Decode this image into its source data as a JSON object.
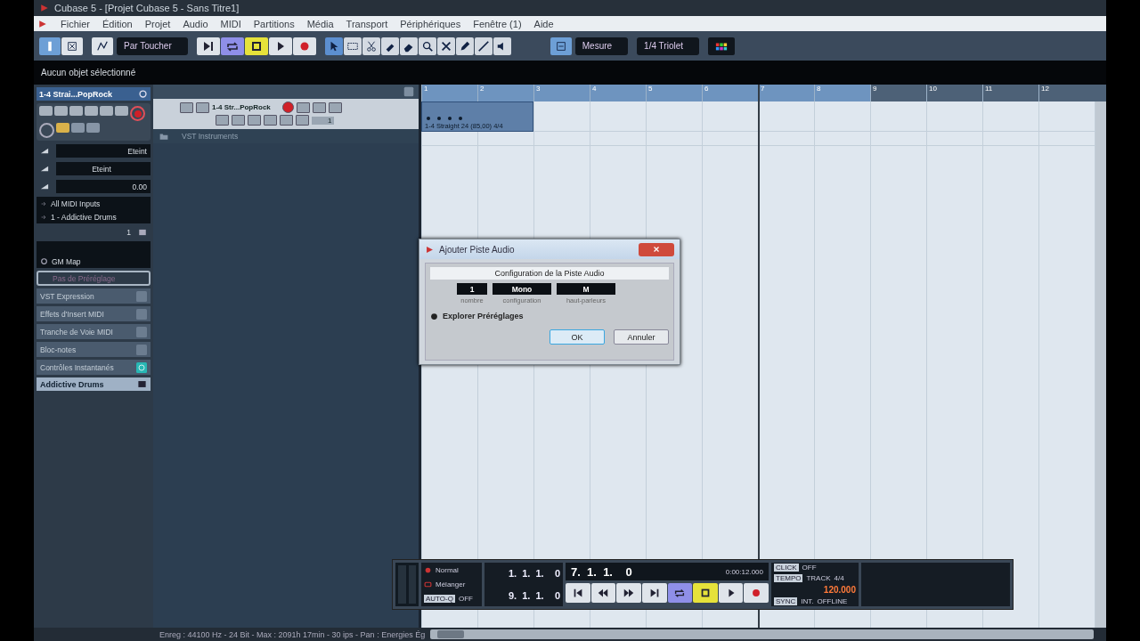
{
  "window": {
    "title": "Cubase 5 - [Projet Cubase 5 - Sans Titre1]"
  },
  "menu": [
    "Fichier",
    "Édition",
    "Projet",
    "Audio",
    "MIDI",
    "Partitions",
    "Média",
    "Transport",
    "Périphériques",
    "Fenêtre (1)",
    "Aide"
  ],
  "toolbar": {
    "automation_mode": "Par Toucher",
    "grid_type": "Mesure",
    "quantize": "1/4 Triolet",
    "transport_buttons": [
      {
        "kind": "goto-end",
        "on": false
      },
      {
        "kind": "cycle",
        "on": true
      },
      {
        "kind": "stop",
        "on": true
      },
      {
        "kind": "play",
        "on": false
      },
      {
        "kind": "record",
        "on": false
      }
    ],
    "tools": [
      {
        "kind": "arrow",
        "selected": true
      },
      {
        "kind": "range",
        "selected": false
      },
      {
        "kind": "split",
        "selected": false
      },
      {
        "kind": "glue",
        "selected": false
      },
      {
        "kind": "eraser",
        "selected": false
      },
      {
        "kind": "zoom",
        "selected": false
      },
      {
        "kind": "mute",
        "selected": false
      },
      {
        "kind": "pencil",
        "selected": false
      },
      {
        "kind": "line",
        "selected": false
      },
      {
        "kind": "play",
        "selected": false
      }
    ],
    "snap": {
      "on": true
    }
  },
  "info_line": "Aucun objet sélectionné",
  "inspector": {
    "track_name": "1-4 Strai...PopRock",
    "record_enabled": true,
    "volume": "Eteint",
    "pan": "Eteint",
    "delay": "0.00",
    "input": "All MIDI Inputs",
    "output": "1 - Addictive Drums",
    "channel": "1",
    "map": "GM Map",
    "preset_placeholder": "Pas de Préréglage",
    "sections": [
      {
        "label": "VST Expression",
        "active": false
      },
      {
        "label": "Effets d'Insert MIDI",
        "active": false
      },
      {
        "label": "Tranche de Voie MIDI",
        "active": false
      },
      {
        "label": "Bloc-notes",
        "active": false
      },
      {
        "label": "Contrôles Instantanés",
        "active": true
      }
    ],
    "instrument": "Addictive Drums"
  },
  "tracks": [
    {
      "kind": "midi",
      "name": "1-4 Str...PopRock",
      "selected": true,
      "record_enabled": true,
      "channel": "1"
    },
    {
      "kind": "folder",
      "name": "VST Instruments",
      "selected": false
    }
  ],
  "ruler": [
    {
      "label": "1",
      "in_cycle": true,
      "playhead": false
    },
    {
      "label": "2",
      "in_cycle": true,
      "playhead": false
    },
    {
      "label": "3",
      "in_cycle": true,
      "playhead": false
    },
    {
      "label": "4",
      "in_cycle": true,
      "playhead": false
    },
    {
      "label": "5",
      "in_cycle": true,
      "playhead": false
    },
    {
      "label": "6",
      "in_cycle": true,
      "playhead": false
    },
    {
      "label": "7",
      "in_cycle": true,
      "playhead": true
    },
    {
      "label": "8",
      "in_cycle": true,
      "playhead": false
    },
    {
      "label": "9",
      "in_cycle": false,
      "playhead": false
    },
    {
      "label": "10",
      "in_cycle": false,
      "playhead": false
    },
    {
      "label": "11",
      "in_cycle": false,
      "playhead": false
    },
    {
      "label": "12",
      "in_cycle": false,
      "playhead": false
    }
  ],
  "part": {
    "label": "1-4 Straight 24 (85,00) 4/4"
  },
  "dialog": {
    "title": "Ajouter Piste Audio",
    "heading": "Configuration de la Piste Audio",
    "fields": [
      {
        "value": "1",
        "label": "nombre"
      },
      {
        "value": "Mono",
        "label": "configuration"
      },
      {
        "value": "M",
        "label": "haut-parleurs"
      }
    ],
    "browse": "Explorer Préréglages",
    "ok": "OK",
    "cancel": "Annuler"
  },
  "transport": {
    "record_mode": "Normal",
    "cycle_mode": "Mélanger",
    "auto_q": "AUTO-Q",
    "auto_q_state": "OFF",
    "left_locator": "1.  1.  1.    0",
    "right_locator": "9.  1.  1.    0",
    "position": "7.  1.  1.    0",
    "time": "0:00:12.000",
    "buttons": [
      {
        "kind": "goto-start",
        "on": false
      },
      {
        "kind": "rewind",
        "on": false
      },
      {
        "kind": "forward",
        "on": false
      },
      {
        "kind": "goto-end",
        "on": false
      },
      {
        "kind": "cycle",
        "on": true
      },
      {
        "kind": "stop",
        "on": true
      },
      {
        "kind": "play",
        "on": false
      },
      {
        "kind": "record",
        "on": false
      }
    ],
    "click": "CLICK",
    "click_state": "OFF",
    "tempo": "TEMPO",
    "tempo_mode": "TRACK",
    "signature": "4/4",
    "bpm": "120.000",
    "sync": "SYNC",
    "sync_source": "INT.",
    "sync_state": "OFFLINE"
  },
  "status_bar": "Enreg : 44100 Hz - 24 Bit - Max : 2091h 17min - 30 ips - Pan : Energies Ég"
}
